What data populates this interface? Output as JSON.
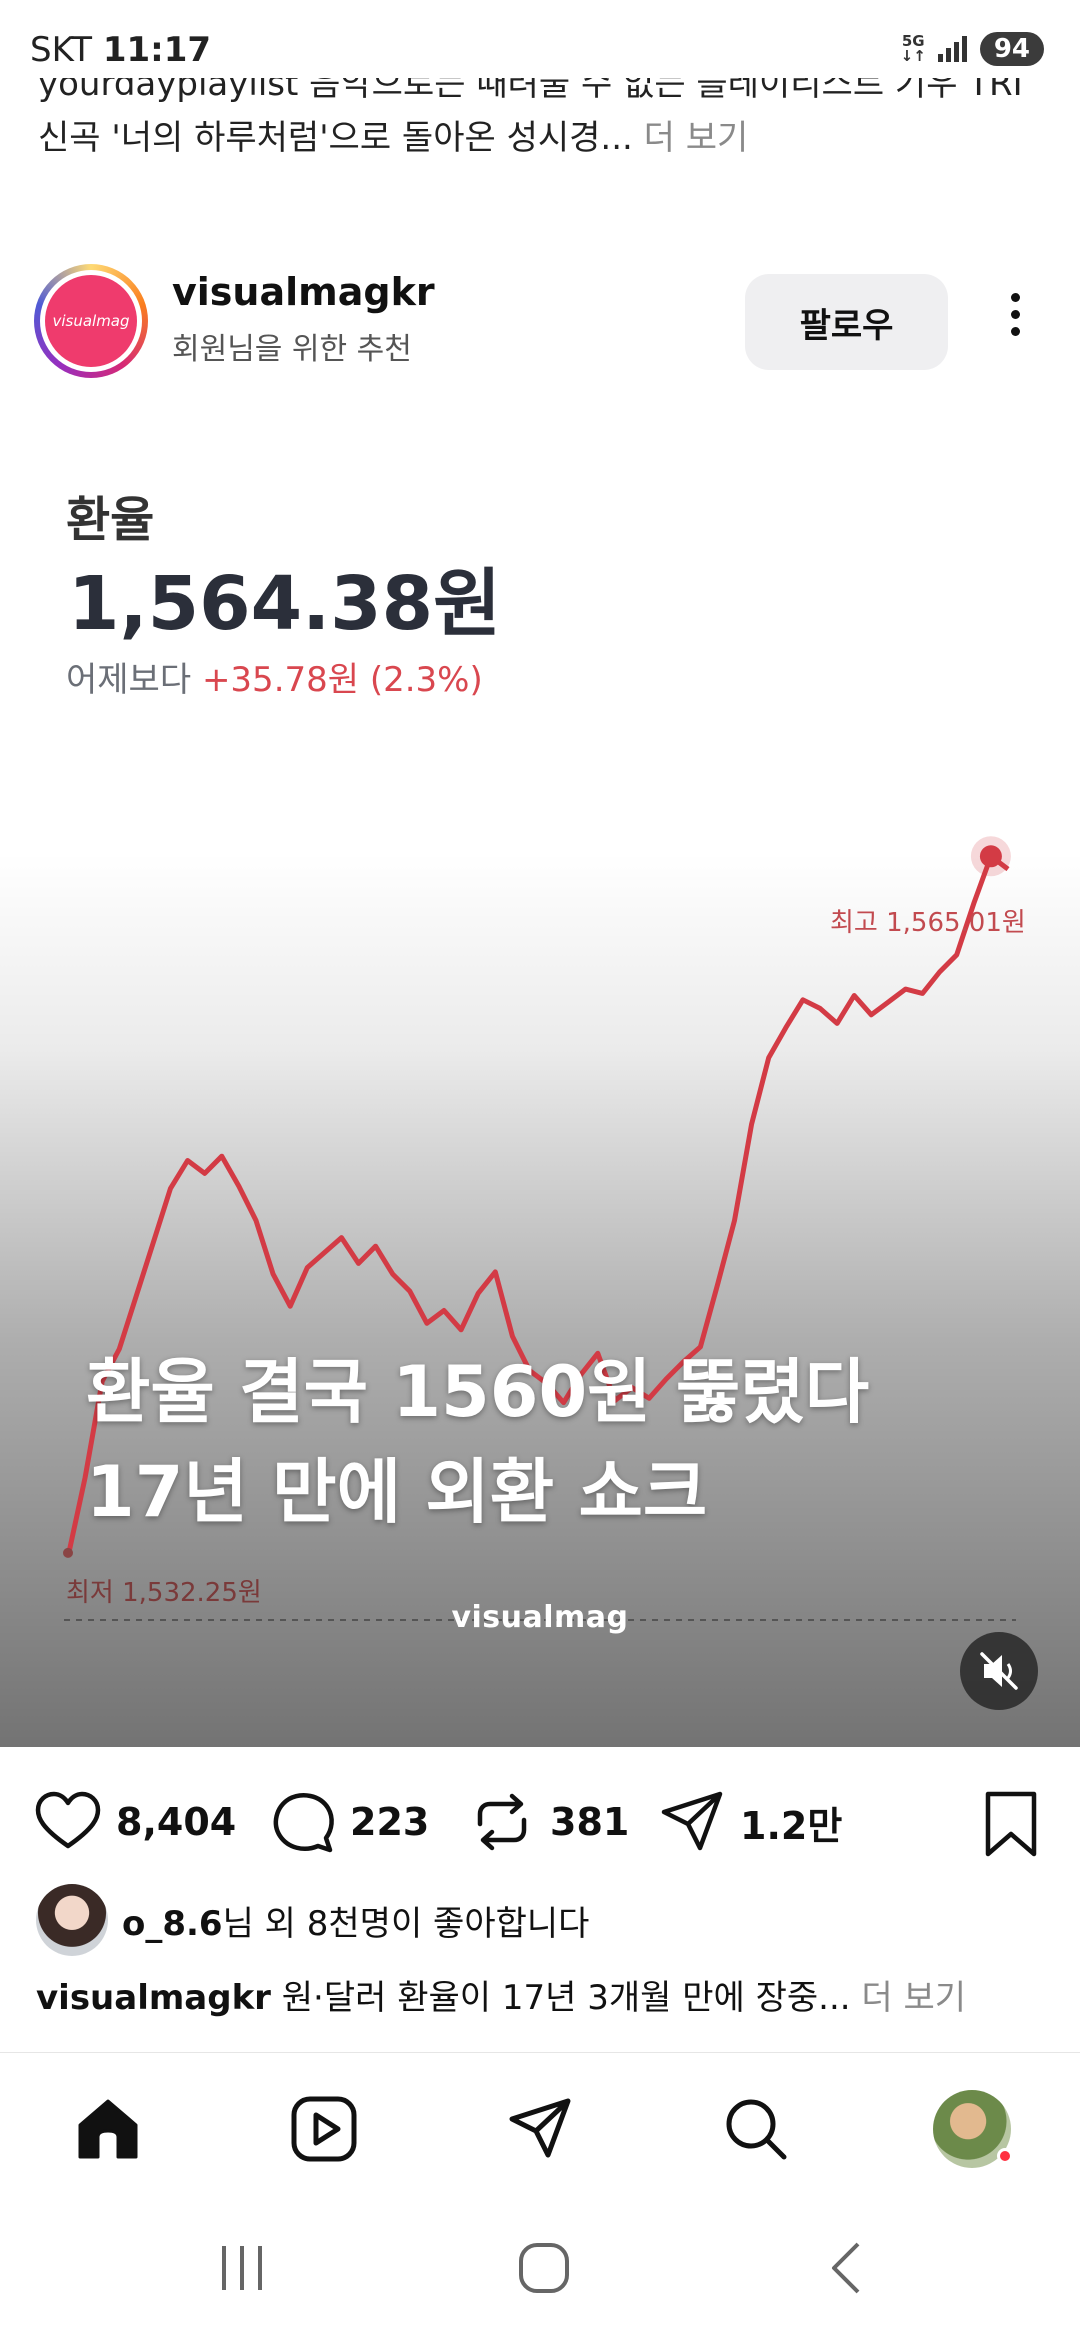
{
  "status_bar": {
    "carrier": "SKT",
    "time": "11:17",
    "network": "5G",
    "battery": "94"
  },
  "previous_post": {
    "caption_line1": "yourdayplaylist 음악으로는 때려줄 수 없는 플레이리스트 기우 TRI",
    "caption_line2": "신곡 '너의 하루처럼'으로 돌아온 성시경...",
    "more": "더 보기"
  },
  "post": {
    "username": "visualmagkr",
    "subtitle": "회원님을 위한 추천",
    "avatar_text": "visualmag",
    "follow_label": "팔로우"
  },
  "media": {
    "fx_title": "환율",
    "fx_rate": "1,564.38원",
    "fx_change_prefix": "어제보다",
    "fx_change_value": "+35.78원 (2.3%)",
    "high_label": "최고 1,565.01원",
    "low_label": "최저 1,532.25원",
    "headline_line1": "환율 결국 1560원 뚫렸다",
    "headline_line2": "17년 만에 외환 쇼크",
    "watermark": "visualmag"
  },
  "chart_data": {
    "type": "line",
    "title": "환율",
    "series": [
      {
        "values": [
          1532.3,
          1536.0,
          1540.5,
          1542.0,
          1544.5,
          1547.0,
          1549.5,
          1550.8,
          1550.2,
          1551.0,
          1549.6,
          1548.0,
          1545.5,
          1544.0,
          1545.8,
          1546.5,
          1547.2,
          1546.0,
          1546.8,
          1545.5,
          1544.7,
          1543.2,
          1543.8,
          1542.9,
          1544.6,
          1545.6,
          1542.6,
          1541.0,
          1540.4,
          1539.5,
          1540.8,
          1541.8,
          1539.6,
          1540.2,
          1539.7,
          1540.6,
          1541.4,
          1542.1,
          1545.0,
          1548.0,
          1552.5,
          1555.6,
          1557.0,
          1558.3,
          1557.9,
          1557.2,
          1558.5,
          1557.6,
          1558.2,
          1558.8,
          1558.6,
          1559.6,
          1560.4,
          1562.8,
          1565.0,
          1564.4
        ]
      }
    ],
    "annotations": [
      "최고 1,565.01원",
      "최저 1,532.25원"
    ],
    "ylim": [
      1528,
      1568
    ],
    "grid": false
  },
  "actions": {
    "likes": "8,404",
    "comments": "223",
    "reposts": "381",
    "shares": "1.2만"
  },
  "liked_by": {
    "user": "o_8.6",
    "text": "님 외 8천명이 좋아합니다"
  },
  "caption": {
    "user": "visualmagkr",
    "text": "원·달러 환율이 17년 3개월 만에 장중...",
    "more": "더 보기"
  },
  "colors": {
    "line": "#d33b45",
    "up": "#d9474f",
    "like_dot": "#ff3040"
  }
}
